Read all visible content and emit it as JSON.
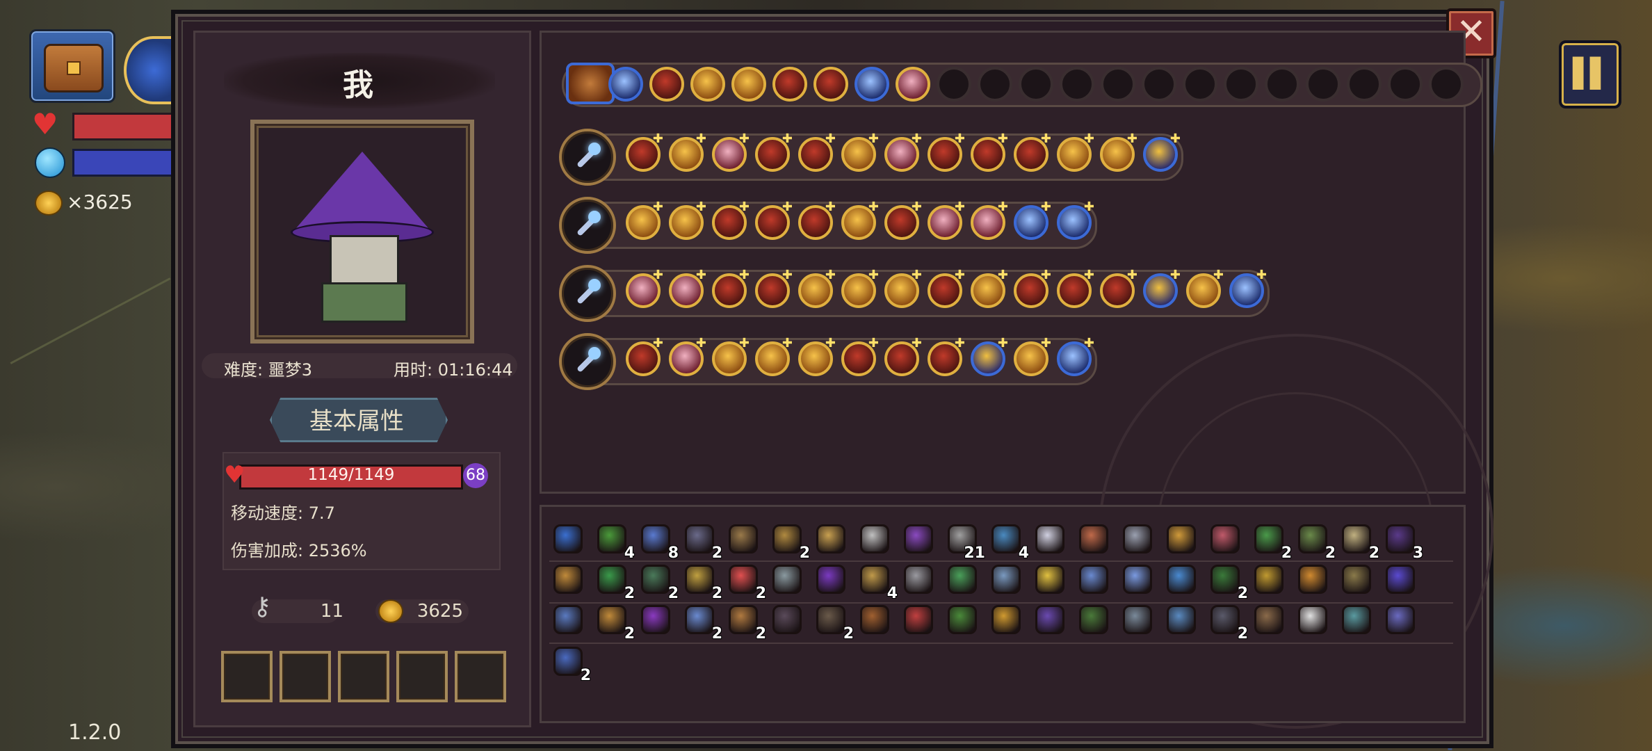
{
  "hud": {
    "gold": "×3625",
    "version": "1.2.0"
  },
  "player": {
    "name": "我",
    "difficulty": "难度: 噩梦3",
    "time": "用时: 01:16:44",
    "attr_tab": "基本属性",
    "hp": "1149/1149",
    "shield": "68",
    "speed": "移动速度: 7.7",
    "damage": "伤害加成: 2536%",
    "keys": "11",
    "gold": "3625"
  },
  "colors": {
    "hp": "#c2393d",
    "mana": "#3a46b8",
    "accent_gold": "#e0b040",
    "panel": "#2a1c26"
  },
  "top_skills": [
    "chest",
    "blue",
    "red",
    "gold",
    "gold",
    "red",
    "red",
    "blue",
    "pink",
    "empty",
    "empty",
    "empty",
    "empty",
    "empty",
    "empty",
    "empty",
    "empty",
    "empty",
    "empty",
    "empty",
    "empty",
    "empty"
  ],
  "weapon_rows": [
    {
      "weapon": "star-staff",
      "skills": [
        "red",
        "gold",
        "pink",
        "red",
        "red",
        "gold",
        "pink",
        "red",
        "red",
        "red",
        "gold",
        "gold",
        "blue2"
      ]
    },
    {
      "weapon": "crystal-staff",
      "skills": [
        "gold",
        "gold",
        "red",
        "red",
        "red",
        "gold",
        "red",
        "pink",
        "pink",
        "blue",
        "blue"
      ]
    },
    {
      "weapon": "ice-staff",
      "skills": [
        "pink",
        "pink",
        "red",
        "red",
        "gold",
        "gold",
        "gold",
        "red",
        "gold",
        "red",
        "red",
        "red",
        "blue2",
        "gold",
        "blue"
      ]
    },
    {
      "weapon": "cannon",
      "skills": [
        "red",
        "pink",
        "gold",
        "gold",
        "gold",
        "red",
        "red",
        "red",
        "blue2",
        "gold",
        "blue"
      ]
    }
  ],
  "items": [
    [
      {
        "c": "#3a6fd0",
        "n": ""
      },
      {
        "c": "#4a9a3a",
        "n": "4"
      },
      {
        "c": "#5a7ad0",
        "n": "8"
      },
      {
        "c": "#6a6a8a",
        "n": "2"
      },
      {
        "c": "#9a7a4a",
        "n": ""
      },
      {
        "c": "#b08a40",
        "n": "2"
      },
      {
        "c": "#c8a050",
        "n": ""
      },
      {
        "c": "#c0c0c0",
        "n": ""
      },
      {
        "c": "#8a4ac0",
        "n": ""
      },
      {
        "c": "#a0a0a0",
        "n": "21"
      },
      {
        "c": "#4a8ac0",
        "n": "4"
      },
      {
        "c": "#d0d0e0",
        "n": ""
      },
      {
        "c": "#c06a4a",
        "n": ""
      },
      {
        "c": "#9aa0b0",
        "n": ""
      },
      {
        "c": "#d09a3a",
        "n": ""
      },
      {
        "c": "#c05a6a",
        "n": ""
      },
      {
        "c": "#4a9a4a",
        "n": "2"
      },
      {
        "c": "#6a8a4a",
        "n": "2"
      },
      {
        "c": "#c0b080",
        "n": "2"
      },
      {
        "c": "#5a3a8a",
        "n": "3"
      }
    ],
    [
      {
        "c": "#c08a3a",
        "n": ""
      },
      {
        "c": "#3a9a4a",
        "n": "2"
      },
      {
        "c": "#4a7a5a",
        "n": "2"
      },
      {
        "c": "#c0a040",
        "n": "2"
      },
      {
        "c": "#e05050",
        "n": "2"
      },
      {
        "c": "#8a9aa0",
        "n": ""
      },
      {
        "c": "#7a3ac0",
        "n": ""
      },
      {
        "c": "#c09a4a",
        "n": "4"
      },
      {
        "c": "#9a9aa0",
        "n": ""
      },
      {
        "c": "#4aa05a",
        "n": ""
      },
      {
        "c": "#7a9ac0",
        "n": ""
      },
      {
        "c": "#e0c040",
        "n": ""
      },
      {
        "c": "#6a8ad0",
        "n": ""
      },
      {
        "c": "#7a9ae0",
        "n": ""
      },
      {
        "c": "#4a8ad0",
        "n": ""
      },
      {
        "c": "#3a7a3a",
        "n": "2"
      },
      {
        "c": "#c09a30",
        "n": ""
      },
      {
        "c": "#d08a30",
        "n": ""
      },
      {
        "c": "#8a7a4a",
        "n": ""
      },
      {
        "c": "#5a4ad0",
        "n": ""
      }
    ],
    [
      {
        "c": "#5a7ac0",
        "n": ""
      },
      {
        "c": "#c08a3a",
        "n": "2"
      },
      {
        "c": "#8a3ac0",
        "n": ""
      },
      {
        "c": "#6a8ad0",
        "n": "2"
      },
      {
        "c": "#b07a40",
        "n": "2"
      },
      {
        "c": "#5a4a5a",
        "n": ""
      },
      {
        "c": "#6a5a4a",
        "n": "2"
      },
      {
        "c": "#a06030",
        "n": ""
      },
      {
        "c": "#c04040",
        "n": ""
      },
      {
        "c": "#4a8a3a",
        "n": ""
      },
      {
        "c": "#d09a30",
        "n": ""
      },
      {
        "c": "#6a4ab0",
        "n": ""
      },
      {
        "c": "#4a7a3a",
        "n": ""
      },
      {
        "c": "#7a8a9a",
        "n": ""
      },
      {
        "c": "#5a8ac0",
        "n": ""
      },
      {
        "c": "#5a5a6a",
        "n": "2"
      },
      {
        "c": "#8a6a4a",
        "n": ""
      },
      {
        "c": "#e0e0e0",
        "n": ""
      },
      {
        "c": "#5a9aa0",
        "n": ""
      },
      {
        "c": "#6a6ac0",
        "n": ""
      }
    ],
    [
      {
        "c": "#4a6ac0",
        "n": "2"
      }
    ]
  ]
}
